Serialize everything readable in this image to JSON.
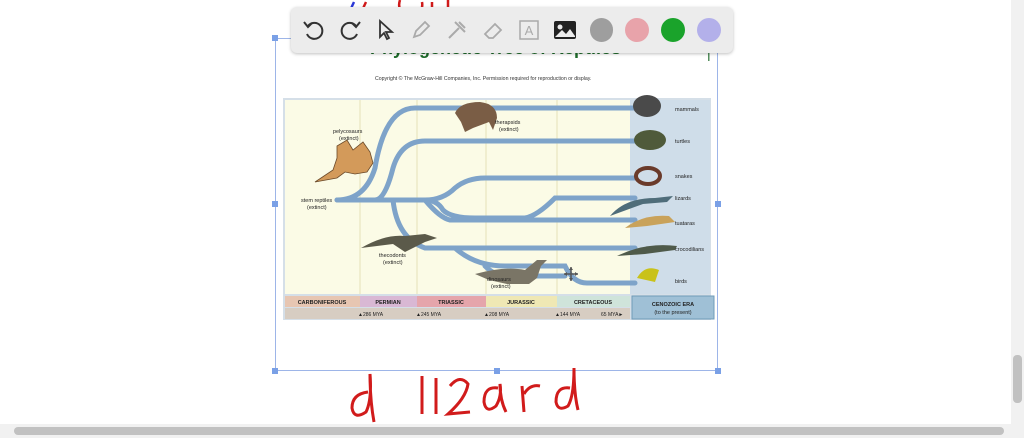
{
  "toolbar": {
    "tools": [
      {
        "name": "undo-icon"
      },
      {
        "name": "redo-icon"
      },
      {
        "name": "select-icon"
      },
      {
        "name": "pencil-icon"
      },
      {
        "name": "tools-icon"
      },
      {
        "name": "eraser-icon"
      },
      {
        "name": "text-icon",
        "label": "A"
      },
      {
        "name": "image-icon"
      }
    ],
    "colors": [
      "#9e9e9e",
      "#e8a3aa",
      "#1aa32b",
      "#b3b0ea"
    ],
    "active_color": "#1aa32b"
  },
  "figure": {
    "title": "Phylogenetic Tree of Reptiles",
    "copyright": "Copyright © The McGraw-Hill Companies, Inc. Permission required for reproduction or display.",
    "annotations": {
      "pelycosaurs": "pelycosaurs",
      "pelycosaurs_sub": "(extinct)",
      "therapsids": "therapsids",
      "therapsids_sub": "(extinct)",
      "stem_reptiles": "stem reptiles",
      "stem_reptiles_sub": "(extinct)",
      "thecodonts": "thecodonts",
      "thecodonts_sub": "(extinct)",
      "dinosaurs": "dinosaurs",
      "dinosaurs_sub": "(extinct)"
    },
    "taxa": [
      "mammals",
      "turtles",
      "snakes",
      "lizards",
      "tuataras",
      "crocodilians",
      "birds"
    ],
    "periods": [
      "CARBONIFEROUS",
      "PERMIAN",
      "TRIASSIC",
      "JURASSIC",
      "CRETACEOUS"
    ],
    "era": "CENOZOIC ERA",
    "era_sub": "(to the present)",
    "mya": [
      "▲286 MYA",
      "▲245 MYA",
      "▲208 MYA",
      "▲144 MYA",
      "65 MYA►"
    ]
  },
  "handwriting": {
    "bottom": "d  lizard"
  }
}
